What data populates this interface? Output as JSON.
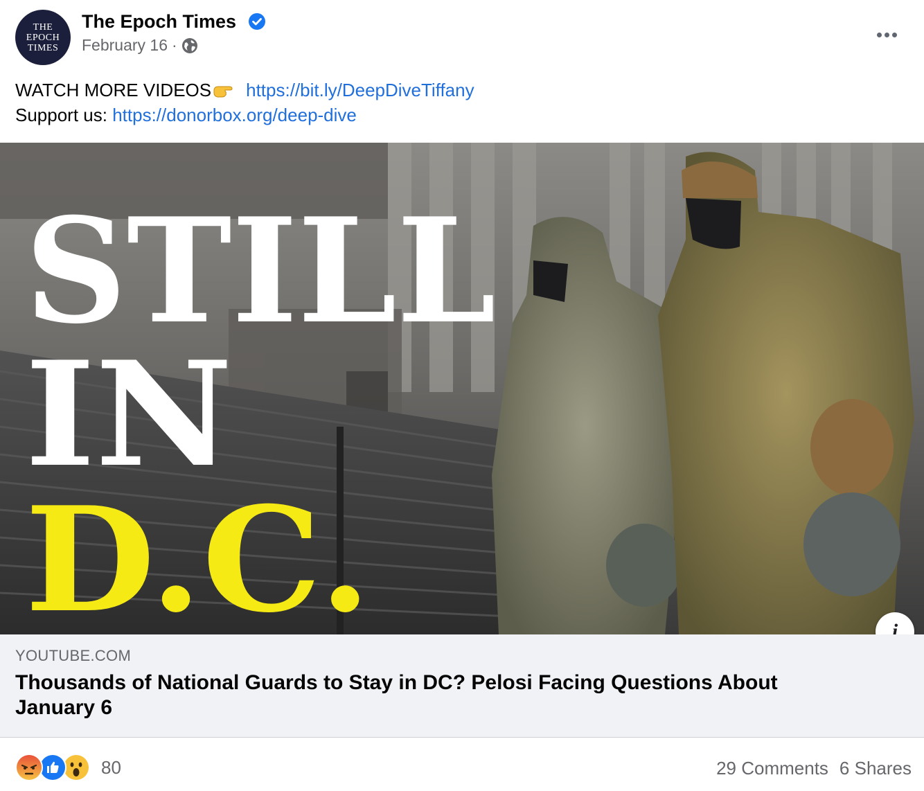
{
  "header": {
    "avatar_lines": [
      "THE",
      "EPOCH",
      "TIMES"
    ],
    "page_name": "The Epoch Times",
    "date": "February 16",
    "separator": "·",
    "icons": [
      "verified-badge-icon",
      "globe-icon",
      "more-options-icon"
    ]
  },
  "message": {
    "line1_text": "WATCH MORE VIDEOS",
    "line1_link": "https://bit.ly/DeepDiveTiffany",
    "line2_text": "Support us: ",
    "line2_link": "https://donorbox.org/deep-dive"
  },
  "media": {
    "overlay_line1": "STILL",
    "overlay_line2": "IN",
    "overlay_line3": "D.C.",
    "accent_white": "#ffffff",
    "accent_yellow": "#f5ea14"
  },
  "link_preview": {
    "domain": "YOUTUBE.COM",
    "title": "Thousands of National Guards to Stay in DC? Pelosi Facing Questions About January 6"
  },
  "footer": {
    "reaction_icons": [
      "angry-reaction-icon",
      "like-reaction-icon",
      "wow-reaction-icon"
    ],
    "reaction_count": "80",
    "comments": "29 Comments",
    "shares": "6 Shares"
  },
  "colors": {
    "link_blue": "#216fdb",
    "secondary_text": "#65676b",
    "verified_blue": "#1877f2",
    "preview_bg": "#f0f2f5"
  }
}
